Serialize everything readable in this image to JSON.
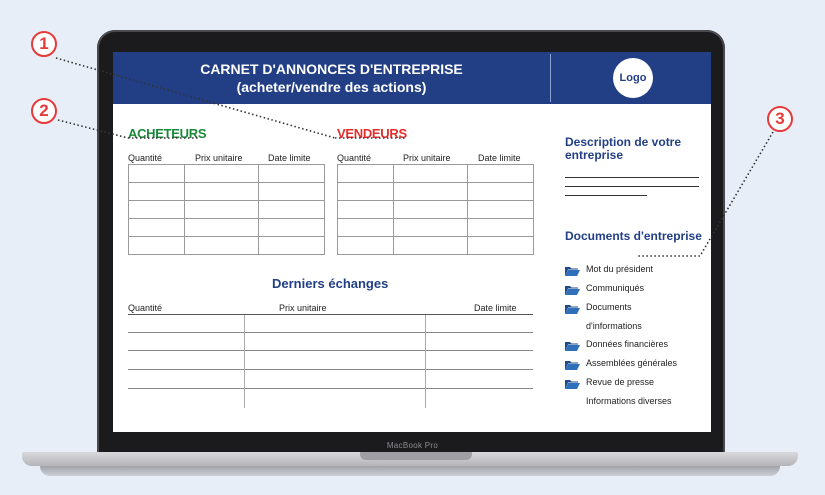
{
  "device": {
    "label": "MacBook Pro"
  },
  "header": {
    "title_line1": "CARNET D'ANNONCES D'ENTREPRISE",
    "title_line2": "(acheter/vendre des actions)",
    "logo": "Logo",
    "color": "#223f86"
  },
  "buyers": {
    "label": "ACHETEURS",
    "color": "#1a8a3a",
    "columns": [
      "Quantité",
      "Prix unitaire",
      "Date limite"
    ]
  },
  "sellers": {
    "label": "VENDEURS",
    "color": "#e52d2d",
    "columns": [
      "Quantité",
      "Prix unitaire",
      "Date limite"
    ]
  },
  "last_trades": {
    "title": "Derniers échanges",
    "columns": [
      "Quantité",
      "Prix unitaire",
      "Date limite"
    ]
  },
  "sidebar": {
    "description_title": "Description de votre entreprise",
    "documents_title": "Documents d'entreprise",
    "documents": [
      "Mot du président",
      "Communiqués",
      "Documents",
      "d'informations",
      "Données financières",
      "Assemblées générales",
      "Revue de presse",
      "Informations diverses"
    ]
  },
  "annotations": [
    "1",
    "2",
    "3"
  ]
}
